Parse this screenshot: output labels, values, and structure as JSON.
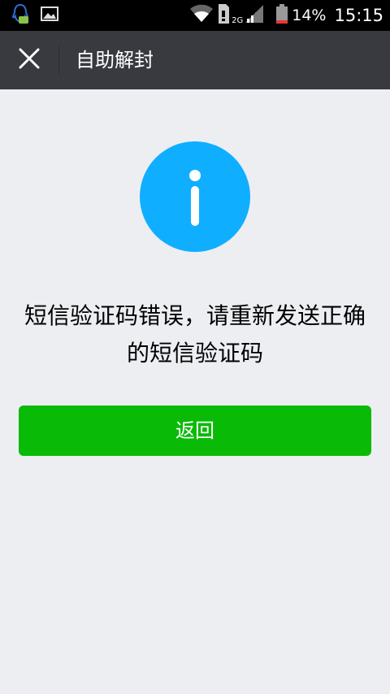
{
  "status_bar": {
    "icons_left": [
      "qq-notification-icon",
      "image-notification-icon"
    ],
    "icons_right": [
      "wifi-icon",
      "sim-icon",
      "signal-2g-icon",
      "battery-icon"
    ],
    "network_label": "2G",
    "battery_percent": "14%",
    "time": "15:15"
  },
  "header": {
    "title": "自助解封",
    "close_icon": "close-icon"
  },
  "main": {
    "icon": "info-icon",
    "message": "短信验证码错误，请重新发送正确的短信验证码",
    "back_button_label": "返回"
  },
  "colors": {
    "status_bar": "#000000",
    "title_bar": "#393a3f",
    "background": "#edeef2",
    "info_icon": "#10aeff",
    "primary_button": "#09bb07",
    "battery_low": "#e53935"
  }
}
